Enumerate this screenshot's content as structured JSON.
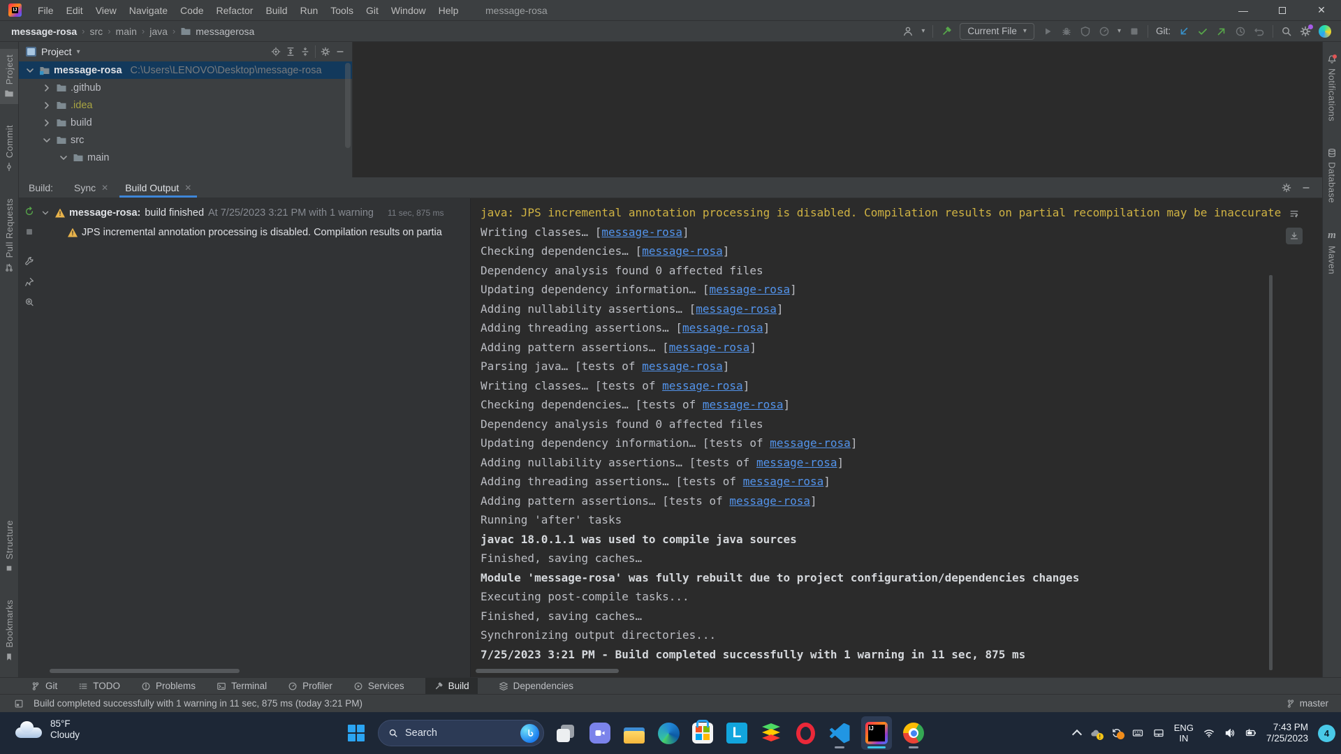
{
  "titlebar": {
    "title": "message-rosa",
    "menus": [
      "File",
      "Edit",
      "View",
      "Navigate",
      "Code",
      "Refactor",
      "Build",
      "Run",
      "Tools",
      "Git",
      "Window",
      "Help"
    ]
  },
  "navbar": {
    "breadcrumbs": [
      "message-rosa",
      "src",
      "main",
      "java",
      "messagerosa"
    ],
    "run_config": "Current File",
    "git_label": "Git:"
  },
  "left_stripe": {
    "top": [
      "Project",
      "Commit",
      "Pull Requests"
    ],
    "bottom": [
      "Structure",
      "Bookmarks"
    ]
  },
  "right_stripe": {
    "items": [
      "Notifications",
      "Database",
      "Maven"
    ]
  },
  "project_panel": {
    "header": "Project",
    "tree": [
      {
        "label": "message-rosa",
        "path": "C:\\Users\\LENOVO\\Desktop\\message-rosa",
        "indent": 0,
        "chevron": "down",
        "selected": true,
        "bold": true,
        "project": true
      },
      {
        "label": ".github",
        "indent": 1,
        "chevron": "right"
      },
      {
        "label": ".idea",
        "indent": 1,
        "chevron": "right",
        "muted": true
      },
      {
        "label": "build",
        "indent": 1,
        "chevron": "right"
      },
      {
        "label": "src",
        "indent": 1,
        "chevron": "down"
      },
      {
        "label": "main",
        "indent": 2,
        "chevron": "down"
      }
    ]
  },
  "build_panel": {
    "label": "Build:",
    "tabs": [
      {
        "label": "Sync",
        "active": false
      },
      {
        "label": "Build Output",
        "active": true
      }
    ],
    "tree": {
      "title_bold": "message-rosa:",
      "title_rest": "build finished",
      "title_meta": "At 7/25/2023 3:21 PM with 1 warning",
      "duration": "11 sec, 875 ms",
      "child_warning": "JPS incremental annotation processing is disabled. Compilation results on partia"
    },
    "console_lines": [
      {
        "style": "warning",
        "segments": [
          [
            "text",
            "java: JPS incremental annotation processing is disabled. Compilation results on partial recompilation may be inaccurate"
          ]
        ]
      },
      {
        "style": "plain",
        "segments": [
          [
            "text",
            "Writing classes… ["
          ],
          [
            "link",
            "message-rosa"
          ],
          [
            "text",
            "]"
          ]
        ]
      },
      {
        "style": "plain",
        "segments": [
          [
            "text",
            "Checking dependencies… ["
          ],
          [
            "link",
            "message-rosa"
          ],
          [
            "text",
            "]"
          ]
        ]
      },
      {
        "style": "plain",
        "segments": [
          [
            "text",
            "Dependency analysis found 0 affected files"
          ]
        ]
      },
      {
        "style": "plain",
        "segments": [
          [
            "text",
            "Updating dependency information… ["
          ],
          [
            "link",
            "message-rosa"
          ],
          [
            "text",
            "]"
          ]
        ]
      },
      {
        "style": "plain",
        "segments": [
          [
            "text",
            "Adding nullability assertions… ["
          ],
          [
            "link",
            "message-rosa"
          ],
          [
            "text",
            "]"
          ]
        ]
      },
      {
        "style": "plain",
        "segments": [
          [
            "text",
            "Adding threading assertions… ["
          ],
          [
            "link",
            "message-rosa"
          ],
          [
            "text",
            "]"
          ]
        ]
      },
      {
        "style": "plain",
        "segments": [
          [
            "text",
            "Adding pattern assertions… ["
          ],
          [
            "link",
            "message-rosa"
          ],
          [
            "text",
            "]"
          ]
        ]
      },
      {
        "style": "plain",
        "segments": [
          [
            "text",
            "Parsing java… [tests of "
          ],
          [
            "link",
            "message-rosa"
          ],
          [
            "text",
            "]"
          ]
        ]
      },
      {
        "style": "plain",
        "segments": [
          [
            "text",
            "Writing classes… [tests of "
          ],
          [
            "link",
            "message-rosa"
          ],
          [
            "text",
            "]"
          ]
        ]
      },
      {
        "style": "plain",
        "segments": [
          [
            "text",
            "Checking dependencies… [tests of "
          ],
          [
            "link",
            "message-rosa"
          ],
          [
            "text",
            "]"
          ]
        ]
      },
      {
        "style": "plain",
        "segments": [
          [
            "text",
            "Dependency analysis found 0 affected files"
          ]
        ]
      },
      {
        "style": "plain",
        "segments": [
          [
            "text",
            "Updating dependency information… [tests of "
          ],
          [
            "link",
            "message-rosa"
          ],
          [
            "text",
            "]"
          ]
        ]
      },
      {
        "style": "plain",
        "segments": [
          [
            "text",
            "Adding nullability assertions… [tests of "
          ],
          [
            "link",
            "message-rosa"
          ],
          [
            "text",
            "]"
          ]
        ]
      },
      {
        "style": "plain",
        "segments": [
          [
            "text",
            "Adding threading assertions… [tests of "
          ],
          [
            "link",
            "message-rosa"
          ],
          [
            "text",
            "]"
          ]
        ]
      },
      {
        "style": "plain",
        "segments": [
          [
            "text",
            "Adding pattern assertions… [tests of "
          ],
          [
            "link",
            "message-rosa"
          ],
          [
            "text",
            "]"
          ]
        ]
      },
      {
        "style": "plain",
        "segments": [
          [
            "text",
            "Running 'after' tasks"
          ]
        ]
      },
      {
        "style": "bold",
        "segments": [
          [
            "text",
            "javac 18.0.1.1 was used to compile java sources"
          ]
        ]
      },
      {
        "style": "plain",
        "segments": [
          [
            "text",
            "Finished, saving caches…"
          ]
        ]
      },
      {
        "style": "bold",
        "segments": [
          [
            "text",
            "Module 'message-rosa' was fully rebuilt due to project configuration/dependencies changes"
          ]
        ]
      },
      {
        "style": "plain",
        "segments": [
          [
            "text",
            "Executing post-compile tasks..."
          ]
        ]
      },
      {
        "style": "plain",
        "segments": [
          [
            "text",
            "Finished, saving caches…"
          ]
        ]
      },
      {
        "style": "plain",
        "segments": [
          [
            "text",
            "Synchronizing output directories..."
          ]
        ]
      },
      {
        "style": "bold",
        "segments": [
          [
            "text",
            "7/25/2023 3:21 PM - Build completed successfully with 1 warning in 11 sec, 875 ms"
          ]
        ]
      }
    ]
  },
  "bottom_bar": {
    "items": [
      {
        "label": "Git",
        "icon": "branch"
      },
      {
        "label": "TODO",
        "icon": "todo"
      },
      {
        "label": "Problems",
        "icon": "problems"
      },
      {
        "label": "Terminal",
        "icon": "terminal"
      },
      {
        "label": "Profiler",
        "icon": "profiler"
      },
      {
        "label": "Services",
        "icon": "services"
      },
      {
        "label": "Build",
        "icon": "hammer",
        "active": true
      },
      {
        "label": "Dependencies",
        "icon": "dependencies"
      }
    ]
  },
  "statusbar": {
    "message": "Build completed successfully with 1 warning in 11 sec, 875 ms (today 3:21 PM)",
    "branch": "master"
  },
  "taskbar": {
    "weather": {
      "temp": "85°F",
      "condition": "Cloudy"
    },
    "search_placeholder": "Search",
    "apps": [
      {
        "name": "task-view"
      },
      {
        "name": "chat"
      },
      {
        "name": "file-explorer"
      },
      {
        "name": "edge"
      },
      {
        "name": "store"
      },
      {
        "name": "ldplayer"
      },
      {
        "name": "bluestacks"
      },
      {
        "name": "opera"
      },
      {
        "name": "vscode",
        "running": true
      },
      {
        "name": "intellij",
        "active": true
      },
      {
        "name": "chrome",
        "running": true
      }
    ],
    "tray": {
      "lang1": "ENG",
      "lang2": "IN",
      "time": "7:43 PM",
      "date": "7/25/2023",
      "badge": "4"
    }
  },
  "colors": {
    "accent_blue": "#3E86D8",
    "link_blue": "#5394EC",
    "warning_yellow": "#D0B343",
    "green": "#57A64A",
    "selection": "#12395C",
    "panel": "#3c3f41",
    "console_bg": "#2b2b2b",
    "taskbar_bg": "#1d2736"
  }
}
